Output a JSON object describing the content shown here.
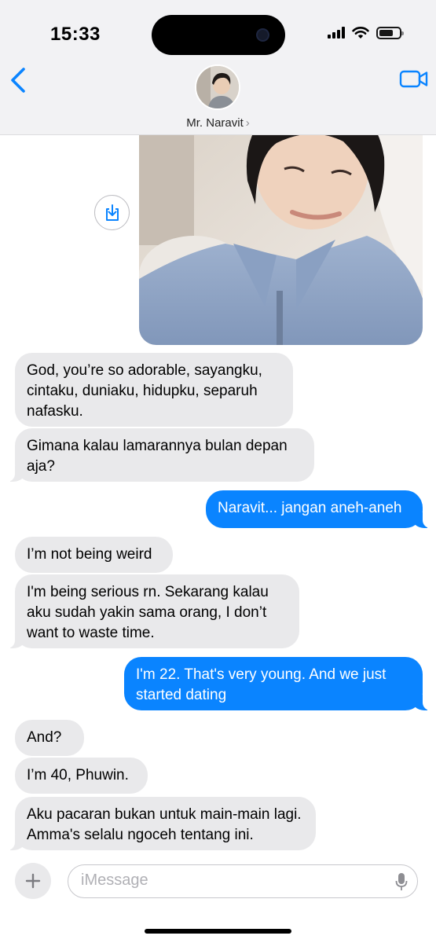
{
  "status_bar": {
    "time": "15:33"
  },
  "header": {
    "contact_name": "Mr. Naravit",
    "chevron": "›"
  },
  "icons": {
    "back": "chevron-left-icon",
    "video": "video-call-icon",
    "save": "save-to-photos-icon",
    "plus": "plus-icon",
    "mic": "microphone-icon"
  },
  "colors": {
    "accent": "#0a84ff",
    "incoming_bubble": "#e9e9eb"
  },
  "messages": [
    {
      "from": "them",
      "text": "God, you’re so adorable, sayangku, cintaku, duniaku, hidupku, separuh nafasku."
    },
    {
      "from": "them",
      "text": "Gimana kalau lamarannya bulan depan aja?"
    },
    {
      "from": "me",
      "text": "Naravit... jangan aneh-aneh"
    },
    {
      "from": "them",
      "text": "I’m not being weird"
    },
    {
      "from": "them",
      "text": "I'm being serious rn. Sekarang kalau aku sudah yakin sama orang, I don’t want to waste time."
    },
    {
      "from": "me",
      "text": "I'm 22. That's very young. And we just started dating"
    },
    {
      "from": "them",
      "text": "And?"
    },
    {
      "from": "them",
      "text": "I’m 40, Phuwin."
    },
    {
      "from": "them",
      "text": "Aku pacaran bukan untuk main-main lagi. Amma's selalu ngoceh tentang ini."
    }
  ],
  "composer": {
    "placeholder": "iMessage"
  }
}
